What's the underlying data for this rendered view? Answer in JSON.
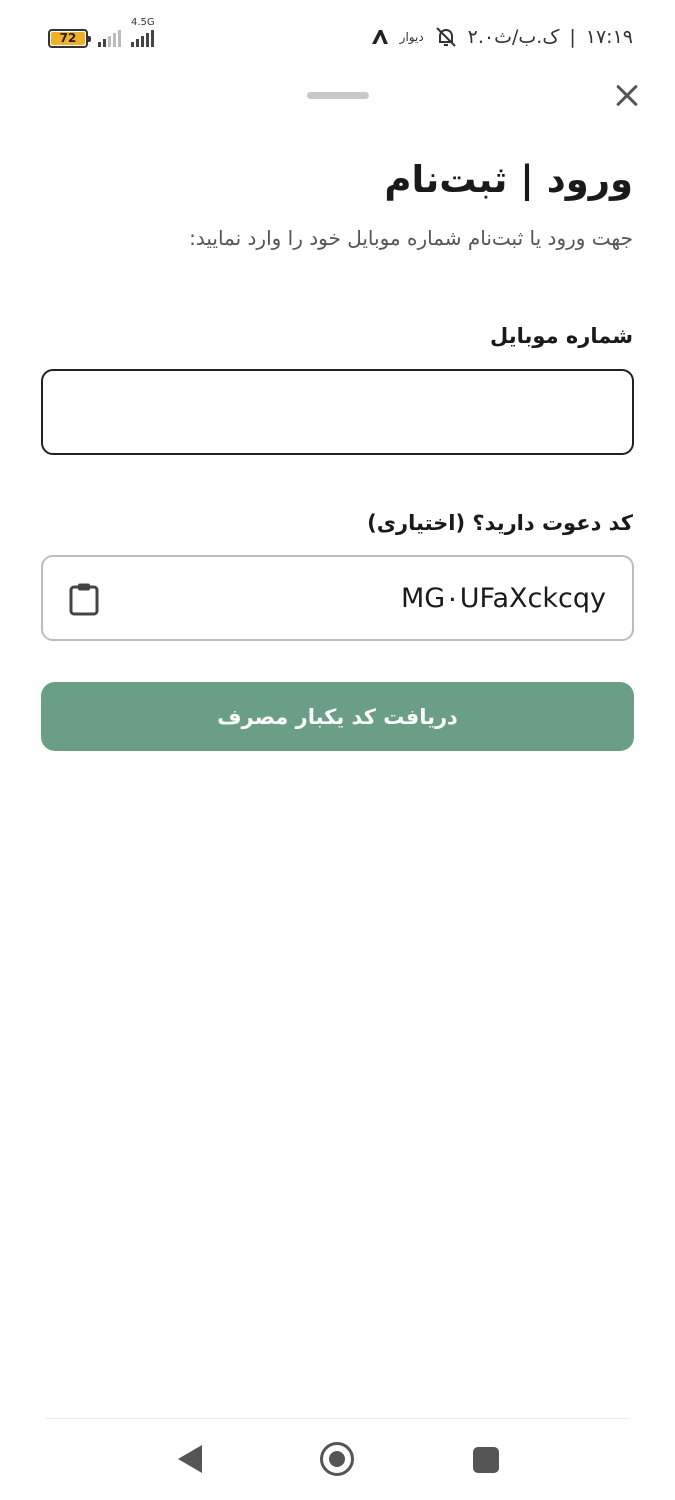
{
  "status_bar": {
    "time": "۱۷:۱۹",
    "separator": "|",
    "date": "۲.۰ک.ب/ث",
    "divar_text": "دیوار",
    "battery_level": "72",
    "network_type": "4.5G"
  },
  "sheet": {
    "title": "ورود | ثبت‌نام",
    "subtitle": "جهت ورود یا ثبت‌نام شماره موبایل خود را وارد نمایید:"
  },
  "form": {
    "mobile_label": "شماره موبایل",
    "mobile_value": "",
    "invite_label": "کد دعوت دارید؟ (اختیاری)",
    "invite_value": "MG۰UFaXckcqy",
    "submit_label": "دریافت کد یکبار مصرف"
  },
  "colors": {
    "accent": "#6a9e87",
    "battery": "#f0b02c"
  },
  "icons": {
    "close": "close-icon",
    "clipboard": "clipboard-icon",
    "nav_back": "back-triangle-icon",
    "nav_home": "home-circle-icon",
    "nav_recents": "recents-square-icon"
  }
}
